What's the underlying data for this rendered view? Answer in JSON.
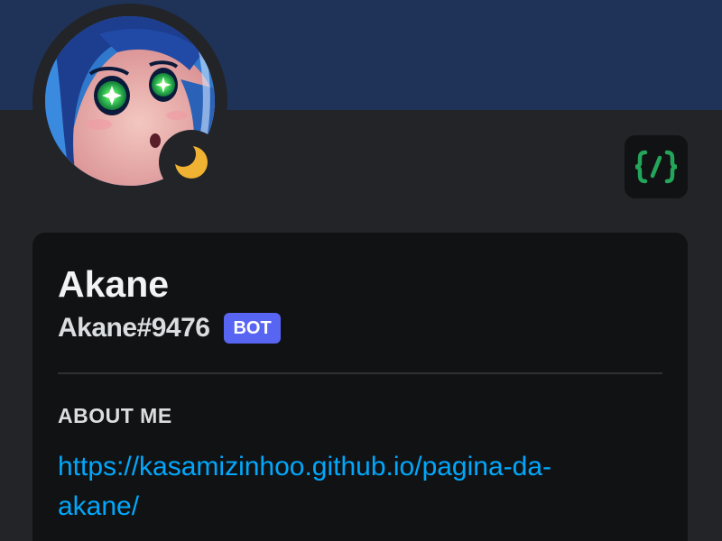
{
  "profile": {
    "display_name": "Akane",
    "username": "Akane#9476",
    "bot_tag": "BOT",
    "status": "idle",
    "avatar_icon": "avatar-image"
  },
  "badges": [
    {
      "icon": "active-developer-icon",
      "label": "{/}"
    }
  ],
  "about": {
    "header": "ABOUT ME",
    "link_line1": "https://kasamizinhoo.github.io/pagina-da-",
    "link_line2": "akane/",
    "link_href": "https://kasamizinhoo.github.io/pagina-da-akane/"
  },
  "colors": {
    "banner": "#1f3257",
    "background": "#232428",
    "card": "#111214",
    "bot_tag": "#5865f2",
    "link": "#00a8fc",
    "idle": "#f0b232",
    "dev_badge": "#23a55a"
  }
}
